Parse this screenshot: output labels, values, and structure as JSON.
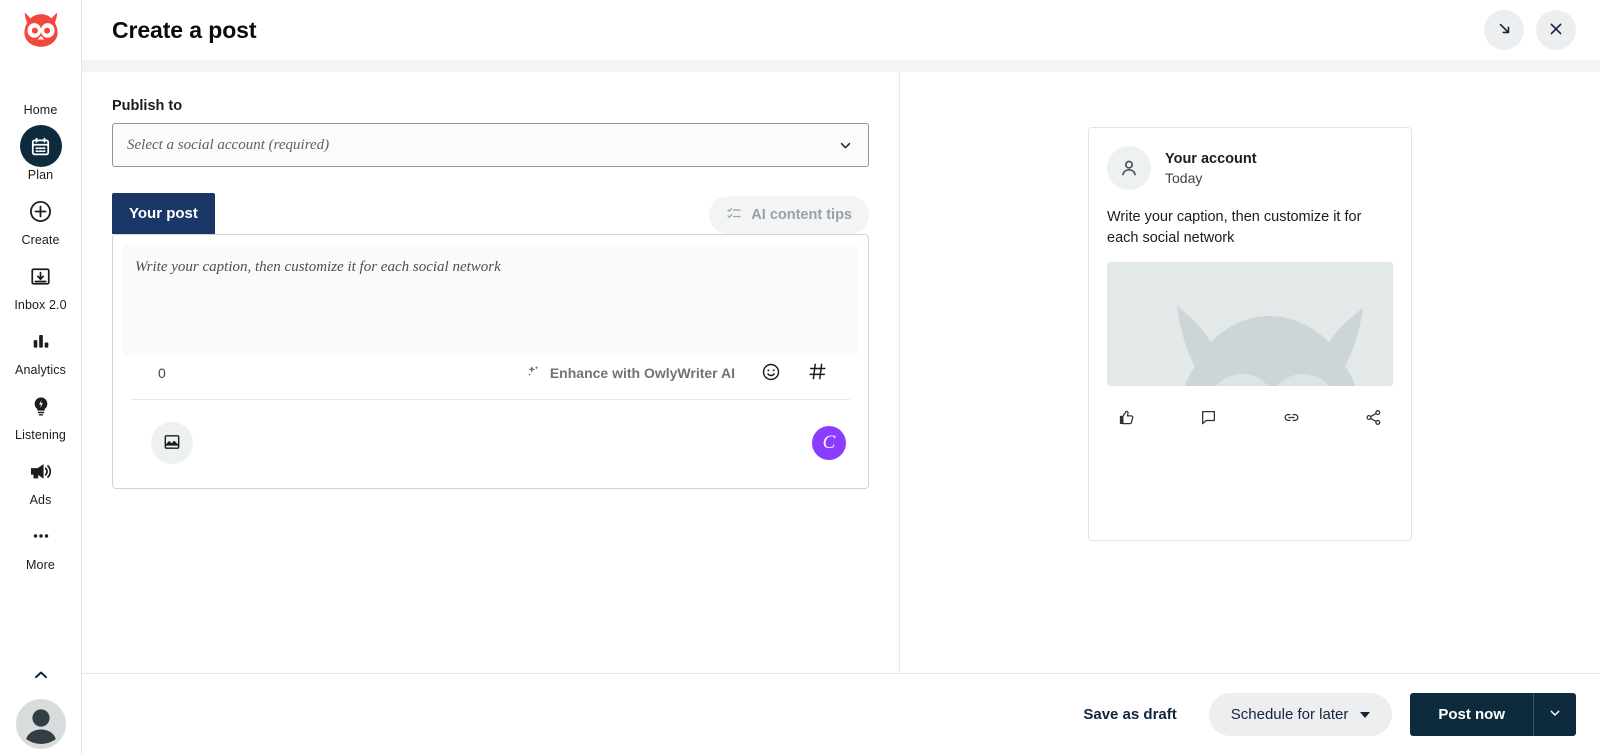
{
  "brand": {
    "logo_icon": "hootsuite-owl-logo",
    "accent_red": "#f4483c",
    "dark_navy": "#0e2b3d",
    "tab_navy": "#1b3767",
    "canva_purple": "#8b3dff"
  },
  "sidebar": {
    "items": [
      {
        "label": "Home",
        "icon": "home-owl-icon",
        "active": false
      },
      {
        "label": "Plan",
        "icon": "calendar-icon",
        "active": true
      },
      {
        "label": "Create",
        "icon": "plus-circle-icon",
        "active": false
      },
      {
        "label": "Inbox 2.0",
        "icon": "inbox-tray-icon",
        "active": false
      },
      {
        "label": "Analytics",
        "icon": "bar-chart-icon",
        "active": false
      },
      {
        "label": "Listening",
        "icon": "lightbulb-icon",
        "active": false
      },
      {
        "label": "Ads",
        "icon": "megaphone-icon",
        "active": false
      },
      {
        "label": "More",
        "icon": "ellipsis-icon",
        "active": false
      }
    ],
    "collapse_icon": "chevron-up-icon",
    "avatar_icon": "user-avatar-icon"
  },
  "header": {
    "title": "Create a post",
    "minimize_icon": "arrow-down-right-icon",
    "close_icon": "close-x-icon"
  },
  "compose": {
    "publish_to_label": "Publish to",
    "account_select_placeholder": "Select a social account (required)",
    "account_select_value": "",
    "select_caret_icon": "chevron-down-icon",
    "tab_label": "Your post",
    "ai_tips_label": "AI content tips",
    "ai_tips_icon": "checklist-icon",
    "caption_placeholder": "Write your caption, then customize it for each social network",
    "caption_value": "",
    "char_count": "0",
    "owlywriter_label": "Enhance with OwlyWriter AI",
    "owlywriter_icon": "sparkles-icon",
    "emoji_icon": "emoji-smiley-icon",
    "hashtag_icon": "hashtag-icon",
    "media_icon": "image-icon",
    "canva_label": "C",
    "canva_icon": "canva-icon"
  },
  "preview": {
    "account_name": "Your account",
    "timestamp": "Today",
    "caption": "Write your caption, then customize it for each social network",
    "avatar_icon": "person-icon",
    "media_icon": "owl-placeholder-icon",
    "actions": [
      {
        "name": "like",
        "icon": "thumbs-up-icon"
      },
      {
        "name": "comment",
        "icon": "comment-bubble-icon"
      },
      {
        "name": "link",
        "icon": "link-chain-icon"
      },
      {
        "name": "share",
        "icon": "share-nodes-icon"
      }
    ]
  },
  "footer": {
    "save_draft_label": "Save as draft",
    "schedule_label": "Schedule for later",
    "schedule_caret_icon": "caret-down-icon",
    "post_now_label": "Post now",
    "post_caret_icon": "chevron-down-icon"
  }
}
